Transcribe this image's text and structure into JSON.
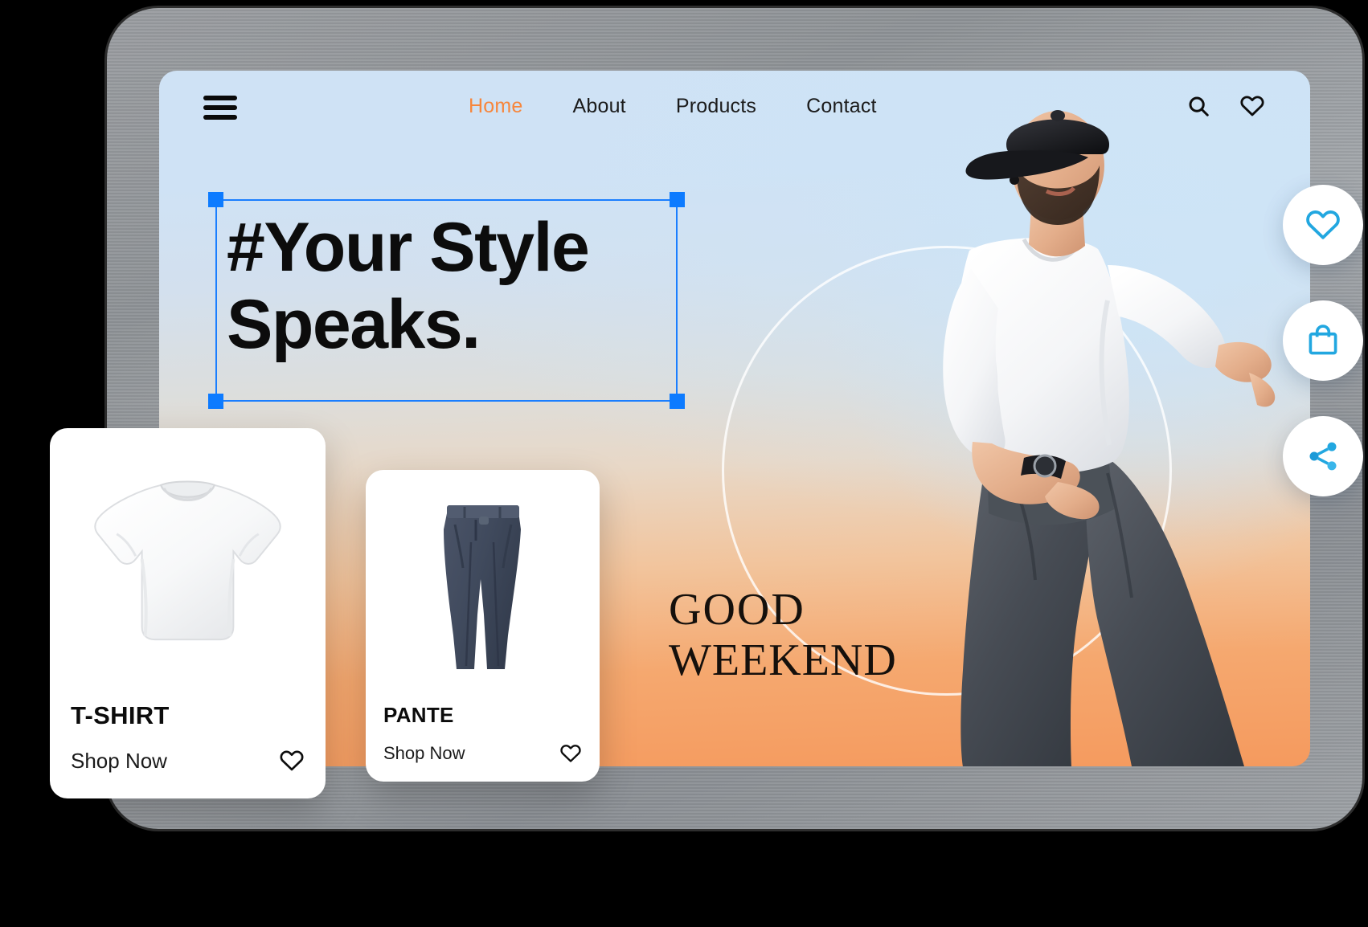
{
  "device": {
    "frame_label": "tablet-device-frame"
  },
  "nav": {
    "menu_icon": "hamburger-menu-icon",
    "links": [
      {
        "label": "Home",
        "active": true
      },
      {
        "label": "About",
        "active": false
      },
      {
        "label": "Products",
        "active": false
      },
      {
        "label": "Contact",
        "active": false
      }
    ],
    "icons": [
      {
        "name": "search-icon"
      },
      {
        "name": "heart-icon"
      }
    ],
    "active_color": "#f7863c",
    "text_color": "#1b1b1b"
  },
  "hero": {
    "headline_line1": "#Your Style",
    "headline_line2": "Speaks.",
    "selection": {
      "color": "#0d7bff",
      "handles": [
        "top-left",
        "top-right",
        "bottom-left",
        "bottom-right"
      ]
    },
    "badge_line1": "GOOD",
    "badge_line2": "WEEKEND",
    "background_gradient": [
      "#cfe2f5",
      "#dcdedd",
      "#f2c49c",
      "#f59a5e"
    ]
  },
  "fabs": [
    {
      "name": "favorite-fab",
      "icon": "heart-icon"
    },
    {
      "name": "shopping-bag-fab",
      "icon": "shopping-bag-icon"
    },
    {
      "name": "share-fab",
      "icon": "share-icon"
    }
  ],
  "fab_icon_color": "#22a7e0",
  "products": [
    {
      "name": "T-SHIRT",
      "cta": "Shop Now",
      "image": "white-tshirt-image",
      "favorite_icon": "heart-icon"
    },
    {
      "name": "PANTE",
      "cta": "Shop Now",
      "image": "navy-trousers-image",
      "favorite_icon": "heart-icon"
    }
  ]
}
